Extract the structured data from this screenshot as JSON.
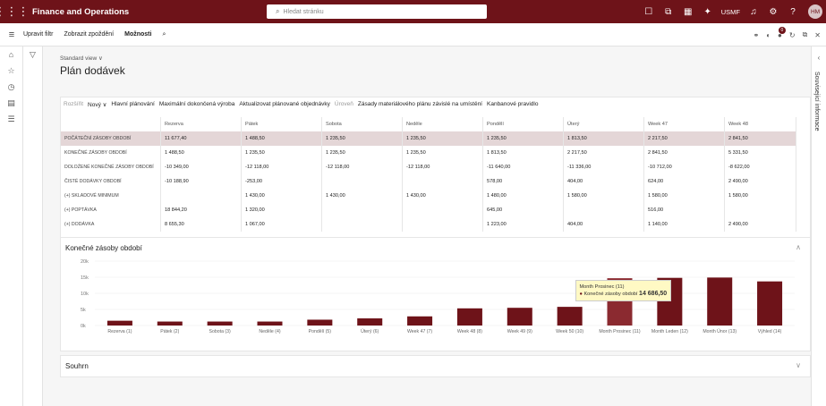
{
  "app": {
    "title": "Finance and Operations",
    "search_placeholder": "Hledat stránku",
    "company": "USMF",
    "user_initials": "HM"
  },
  "actionbar": {
    "edit_filter": "Upravit filtr",
    "show_delays": "Zobrazit zpoždění",
    "options": "Možnosti"
  },
  "page": {
    "view": "Standard view ∨",
    "title": "Plán dodávek",
    "side_panel": "Související informace"
  },
  "grid_commands": [
    {
      "label": "Rozšířit",
      "disabled": true
    },
    {
      "label": "Nový ∨",
      "disabled": false
    },
    {
      "label": "Hlavní plánování",
      "disabled": false
    },
    {
      "label": "Maximální dokončená výroba",
      "disabled": false
    },
    {
      "label": "Aktualizovat plánované objednávky",
      "disabled": false
    },
    {
      "label": "Úroveň",
      "disabled": true
    },
    {
      "label": "Zásady materiálového plánu závislé na umístění",
      "disabled": false
    },
    {
      "label": "Kanbanové pravidlo",
      "disabled": false
    }
  ],
  "grid": {
    "columns": [
      "",
      "Rezerva",
      "Pátek",
      "Sobota",
      "Neděle",
      "Pondělí",
      "Úterý",
      "Week 47",
      "Week 48"
    ],
    "rows": [
      {
        "label": "Počáteční zásoby období",
        "selected": true,
        "values": [
          "11 677,40",
          "1 488,50",
          "1 235,50",
          "1 235,50",
          "1 235,50",
          "1 813,50",
          "2 217,50",
          "2 841,50"
        ]
      },
      {
        "label": "Konečné zásoby období",
        "selected": false,
        "values": [
          "1 488,50",
          "1 235,50",
          "1 235,50",
          "1 235,50",
          "1 813,50",
          "2 217,50",
          "2 841,50",
          "5 331,50"
        ]
      },
      {
        "label": "Doložené konečné zásoby období",
        "selected": false,
        "values": [
          "-10 349,00",
          "-12 118,00",
          "-12 118,00",
          "-12 118,00",
          "-11 640,00",
          "-11 336,00",
          "-10 712,00",
          "-8 622,00"
        ]
      },
      {
        "label": "Čisté dodávky období",
        "selected": false,
        "values": [
          "-10 188,90",
          "-253,00",
          "",
          "",
          "578,00",
          "404,00",
          "624,00",
          "2 490,00"
        ]
      },
      {
        "label": "(+) Skladové minimum",
        "selected": false,
        "values": [
          "",
          "1 430,00",
          "1 430,00",
          "1 430,00",
          "1 480,00",
          "1 580,00",
          "1 580,00",
          "1 580,00"
        ]
      },
      {
        "label": "(+) Poptávka",
        "selected": false,
        "values": [
          "18 844,20",
          "1 320,00",
          "",
          "",
          "645,00",
          "",
          "516,00",
          ""
        ]
      },
      {
        "label": "(+) Dodávka",
        "selected": false,
        "values": [
          "8 655,30",
          "1 067,00",
          "",
          "",
          "1 223,00",
          "404,00",
          "1 140,00",
          "2 490,00"
        ]
      }
    ]
  },
  "chart_section_title": "Konečné zásoby období",
  "summary_section_title": "Souhrn",
  "tooltip": {
    "title": "Month Prosinec (11)",
    "series": "Konečné zásoby období",
    "value": "14 686,50"
  },
  "colors": {
    "brand": "#6e1319",
    "bar": "#6e1319",
    "bar_highlight": "#8b2a30"
  },
  "chart_data": {
    "type": "bar",
    "categories": [
      "Rezerva (1)",
      "Pátek (2)",
      "Sobota (3)",
      "Neděle (4)",
      "Pondělí (5)",
      "Úterý (6)",
      "Week 47 (7)",
      "Week 48 (8)",
      "Week 49 (9)",
      "Week 50 (10)",
      "Month Prosinec (11)",
      "Month Leden (12)",
      "Month Únor (13)",
      "Výhled (14)"
    ],
    "values": [
      1488.5,
      1235.5,
      1235.5,
      1235.5,
      1813.5,
      2217.5,
      2841.5,
      5331.5,
      5500,
      5800,
      14686.5,
      14800,
      14900,
      13700
    ],
    "yticks": [
      "0k",
      "5k",
      "10k",
      "15k",
      "20k"
    ],
    "ylim": [
      0,
      20000
    ],
    "highlight_index": 10,
    "series": [
      {
        "name": "Konečné zásoby období"
      }
    ]
  }
}
